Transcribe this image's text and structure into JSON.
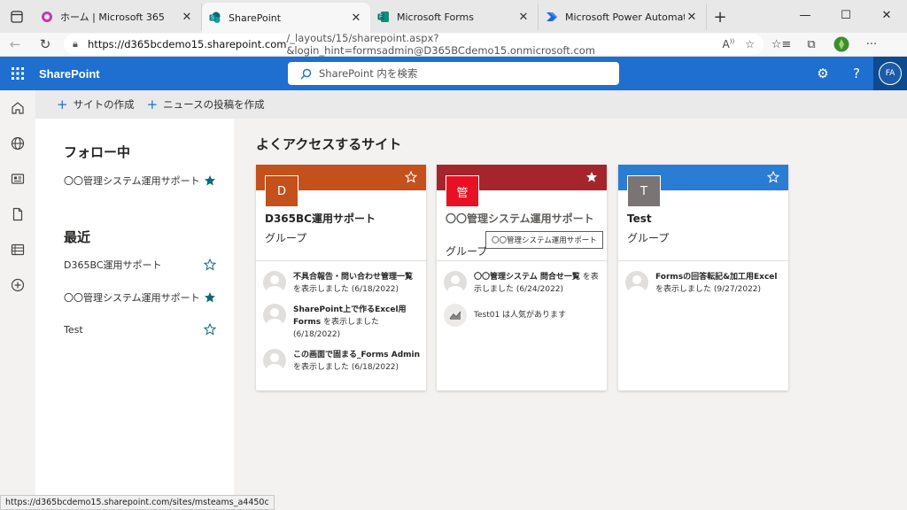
{
  "browser": {
    "tabs": [
      {
        "title": "ホーム | Microsoft 365",
        "active": false
      },
      {
        "title": "SharePoint",
        "active": true
      },
      {
        "title": "Microsoft Forms",
        "active": false
      },
      {
        "title": "Microsoft Power Automate",
        "active": false
      }
    ],
    "url_host": "https://d365bcdemo15.sharepoint.com",
    "url_path": "/_layouts/15/sharepoint.aspx?&login_hint=formsadmin@D365BCdemo15.onmicrosoft.com",
    "status_url": "https://d365bcdemo15.sharepoint.com/sites/msteams_a4450c"
  },
  "suitebar": {
    "app_name": "SharePoint",
    "search_placeholder": "SharePoint 内を検索",
    "avatar_initials": "FA"
  },
  "commands": {
    "create_site": "サイトの作成",
    "create_news": "ニュースの投稿を作成"
  },
  "left": {
    "following_heading": "フォロー中",
    "following": [
      {
        "label": "〇〇管理システム運用サポート",
        "starred": true
      }
    ],
    "recent_heading": "最近",
    "recent": [
      {
        "label": "D365BC運用サポート",
        "starred": false
      },
      {
        "label": "〇〇管理システム運用サポート",
        "starred": true
      },
      {
        "label": "Test",
        "starred": false
      }
    ]
  },
  "main": {
    "title": "よくアクセスするサイト",
    "tooltip": "〇〇管理システム運用サポート",
    "cards": [
      {
        "logo": "D",
        "name": "D365BC運用サポート",
        "type": "グループ",
        "band_color": "#c4501b",
        "logo_color": "#c4501b",
        "starred": false,
        "activities": [
          {
            "icon": "person-icon",
            "title": "不具合報告・問い合わせ管理一覧",
            "rest": " を表示しました (6/18/2022)"
          },
          {
            "icon": "person-icon",
            "title": "SharePoint上で作るExcel用Forms",
            "rest": " を表示しました (6/18/2022)"
          },
          {
            "icon": "person-icon",
            "title": "この画面で固まる_Forms Admin",
            "rest": " を表示しました (6/18/2022)"
          }
        ]
      },
      {
        "logo": "管",
        "name": "〇〇管理システム運用サポート",
        "type": "グループ",
        "band_color": "#a4262c",
        "logo_color": "#e81123",
        "starred": true,
        "activities": [
          {
            "icon": "person-icon",
            "title": "〇〇管理システム 問合せ一覧",
            "rest": " を表示しました (6/24/2022)"
          },
          {
            "icon": "trending-icon",
            "title": "",
            "rest": "Test01 は人気があります"
          }
        ]
      },
      {
        "logo": "T",
        "name": "Test",
        "type": "グループ",
        "band_color": "#2b7cd3",
        "logo_color": "#7a7574",
        "starred": false,
        "activities": [
          {
            "icon": "person-icon",
            "title": "Formsの回答転記&加工用Excel",
            "rest": " を表示しました (9/27/2022)"
          }
        ]
      }
    ]
  }
}
